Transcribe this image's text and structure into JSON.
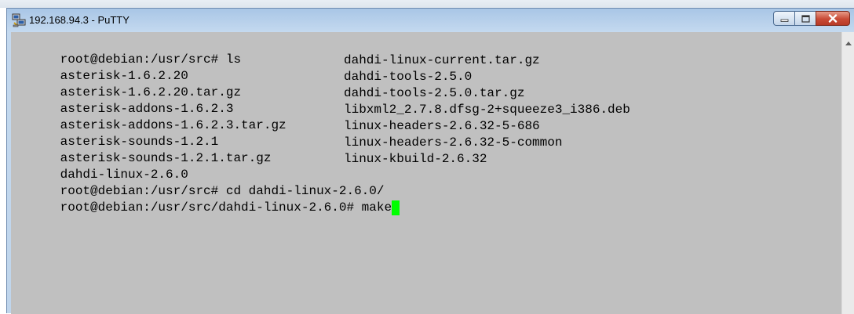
{
  "window": {
    "title": "192.168.94.3 - PuTTY",
    "app_icon": "putty-computer-icon",
    "controls": [
      "minimize-icon",
      "maximize-icon",
      "close-icon"
    ]
  },
  "terminal": {
    "background": "#c0c0c0",
    "cursor_color": "#00ff00",
    "lines": [
      {
        "col1": "root@debian:/usr/src# ls",
        "col2": ""
      },
      {
        "col1": "asterisk-1.6.2.20",
        "col2": "dahdi-linux-current.tar.gz"
      },
      {
        "col1": "asterisk-1.6.2.20.tar.gz",
        "col2": "dahdi-tools-2.5.0"
      },
      {
        "col1": "asterisk-addons-1.6.2.3",
        "col2": "dahdi-tools-2.5.0.tar.gz"
      },
      {
        "col1": "asterisk-addons-1.6.2.3.tar.gz",
        "col2": "libxml2_2.7.8.dfsg-2+squeeze3_i386.deb"
      },
      {
        "col1": "asterisk-sounds-1.2.1",
        "col2": "linux-headers-2.6.32-5-686"
      },
      {
        "col1": "asterisk-sounds-1.2.1.tar.gz",
        "col2": "linux-headers-2.6.32-5-common"
      },
      {
        "col1": "dahdi-linux-2.6.0",
        "col2": "linux-kbuild-2.6.32"
      },
      {
        "col1": "root@debian:/usr/src# cd dahdi-linux-2.6.0/",
        "col2": ""
      },
      {
        "col1": "root@debian:/usr/src/dahdi-linux-2.6.0# make",
        "col2": ""
      }
    ]
  }
}
